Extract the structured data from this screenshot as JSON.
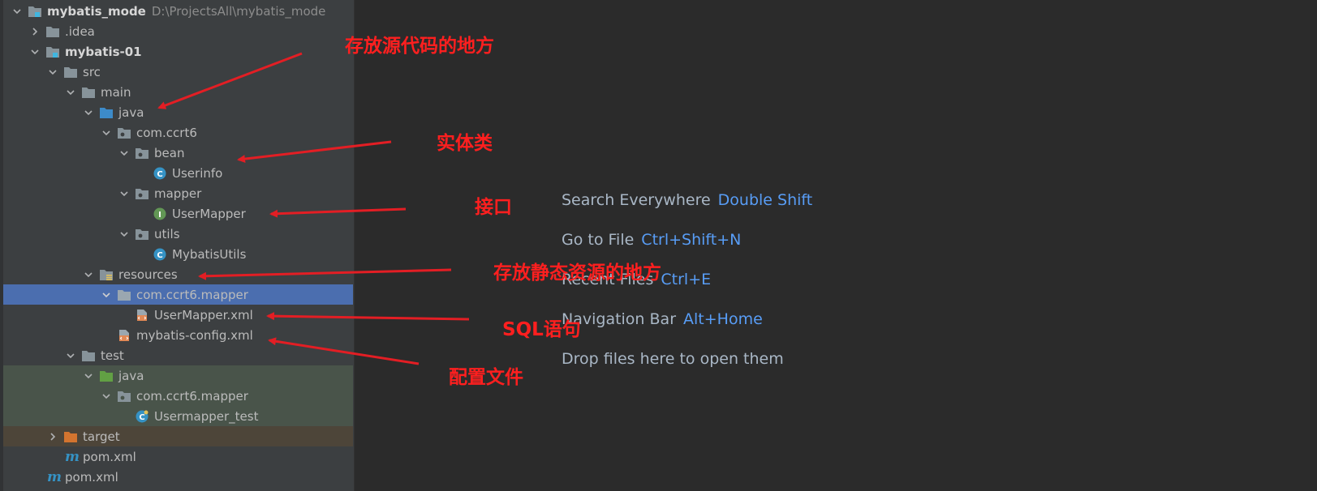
{
  "project_tree": {
    "rows": [
      {
        "id": "r0",
        "label": "mybatis_mode",
        "path": "D:\\ProjectsAll\\mybatis_mode"
      },
      {
        "id": "r1",
        "label": ".idea"
      },
      {
        "id": "r2",
        "label": "mybatis-01"
      },
      {
        "id": "r3",
        "label": "src"
      },
      {
        "id": "r4",
        "label": "main"
      },
      {
        "id": "r5",
        "label": "java"
      },
      {
        "id": "r6",
        "label": "com.ccrt6"
      },
      {
        "id": "r7",
        "label": "bean"
      },
      {
        "id": "r8",
        "label": "Userinfo"
      },
      {
        "id": "r9",
        "label": "mapper"
      },
      {
        "id": "r10",
        "label": "UserMapper"
      },
      {
        "id": "r11",
        "label": "utils"
      },
      {
        "id": "r12",
        "label": "MybatisUtils"
      },
      {
        "id": "r13",
        "label": "resources"
      },
      {
        "id": "r14",
        "label": "com.ccrt6.mapper"
      },
      {
        "id": "r15",
        "label": "UserMapper.xml"
      },
      {
        "id": "r16",
        "label": "mybatis-config.xml"
      },
      {
        "id": "r17",
        "label": "test"
      },
      {
        "id": "r18",
        "label": "java"
      },
      {
        "id": "r19",
        "label": "com.ccrt6.mapper"
      },
      {
        "id": "r20",
        "label": "Usermapper_test"
      },
      {
        "id": "r21",
        "label": "target"
      },
      {
        "id": "r22",
        "label": "pom.xml"
      },
      {
        "id": "r23",
        "label": "pom.xml"
      }
    ]
  },
  "editor_hints": [
    {
      "text": "Search Everywhere",
      "shortcut": "Double Shift"
    },
    {
      "text": "Go to File",
      "shortcut": "Ctrl+Shift+N"
    },
    {
      "text": "Recent Files",
      "shortcut": "Ctrl+E"
    },
    {
      "text": "Navigation Bar",
      "shortcut": "Alt+Home"
    },
    {
      "text": "Drop files here to open them",
      "shortcut": ""
    }
  ],
  "annotations": [
    {
      "text": "存放源代码的地方"
    },
    {
      "text": "实体类"
    },
    {
      "text": "接口"
    },
    {
      "text": "存放静态资源的地方"
    },
    {
      "text": "SQL语句"
    },
    {
      "text": "配置文件"
    }
  ],
  "colors": {
    "annotation": "#ff1f1f",
    "selection": "#4b6eaf",
    "shortcut": "#589df6",
    "panel_bg": "#3c3f41",
    "editor_bg": "#2b2b2b"
  }
}
